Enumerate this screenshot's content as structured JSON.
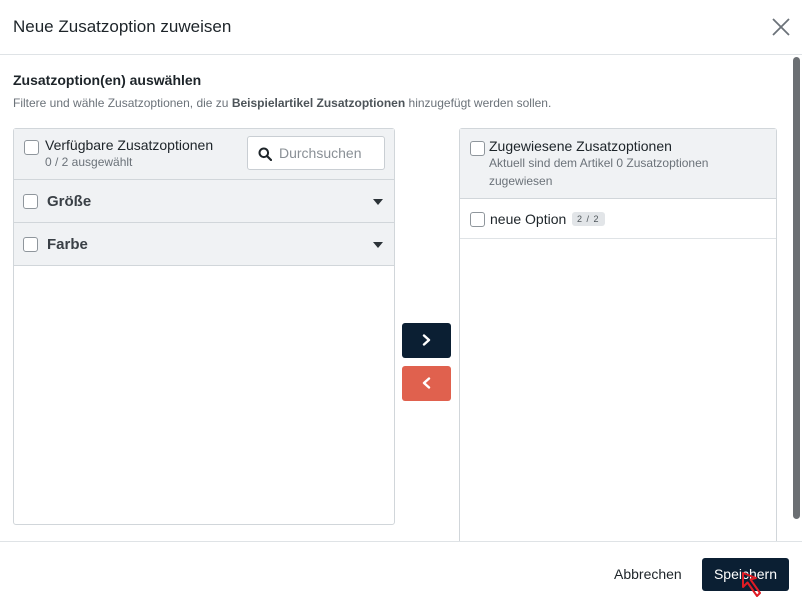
{
  "modal": {
    "title": "Neue Zusatzoption zuweisen"
  },
  "section": {
    "title": "Zusatzoption(en) auswählen",
    "desc_before": "Filtere und wähle Zusatzoptionen, die zu",
    "desc_product": "Beispielartikel Zusatzoptionen",
    "desc_after": "hinzugefügt werden sollen."
  },
  "available": {
    "title": "Verfügbare Zusatzoptionen",
    "selected_count": "0 / 2 ausgewählt",
    "search_placeholder": "Durchsuchen",
    "groups": [
      {
        "label": "Größe"
      },
      {
        "label": "Farbe"
      }
    ]
  },
  "assigned": {
    "title": "Zugewiesene Zusatzoptionen",
    "subtitle_line1": "Aktuell sind dem Artikel 0 Zusatzoptionen",
    "subtitle_line2": "zugewiesen",
    "options": [
      {
        "label": "neue Option",
        "badge": "2 / 2"
      }
    ]
  },
  "footer": {
    "cancel_label": "Abbrechen",
    "save_label": "Speichern"
  },
  "icons": {
    "close": "close-icon",
    "search": "search-icon",
    "move_right": "chevron-right-icon",
    "move_left": "chevron-left-icon",
    "group_toggle": "caret-down-icon",
    "cursor": "pointer-cursor-icon"
  },
  "colors": {
    "primary": "#0b1f33",
    "danger": "#e0614e",
    "panel_header": "#f0f2f4",
    "border": "#d1d6da"
  }
}
